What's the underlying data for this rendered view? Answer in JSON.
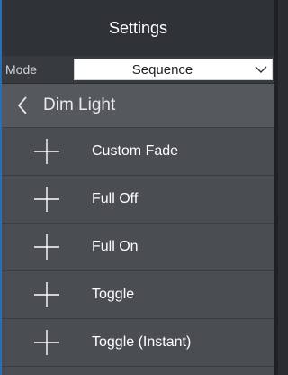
{
  "header": {
    "title": "Settings"
  },
  "mode": {
    "label": "Mode",
    "selected": "Sequence"
  },
  "nav": {
    "title": "Dim Light"
  },
  "items": [
    {
      "label": "Custom Fade"
    },
    {
      "label": "Full Off"
    },
    {
      "label": "Full On"
    },
    {
      "label": "Toggle"
    },
    {
      "label": "Toggle (Instant)"
    }
  ],
  "icons": {
    "back": "chevron-left-icon",
    "dropdown": "chevron-down-icon",
    "add": "plus-icon"
  },
  "colors": {
    "accent_border": "#2b6fb3",
    "header_bg": "#2f3236",
    "panel_bg": "#4a4d52"
  }
}
